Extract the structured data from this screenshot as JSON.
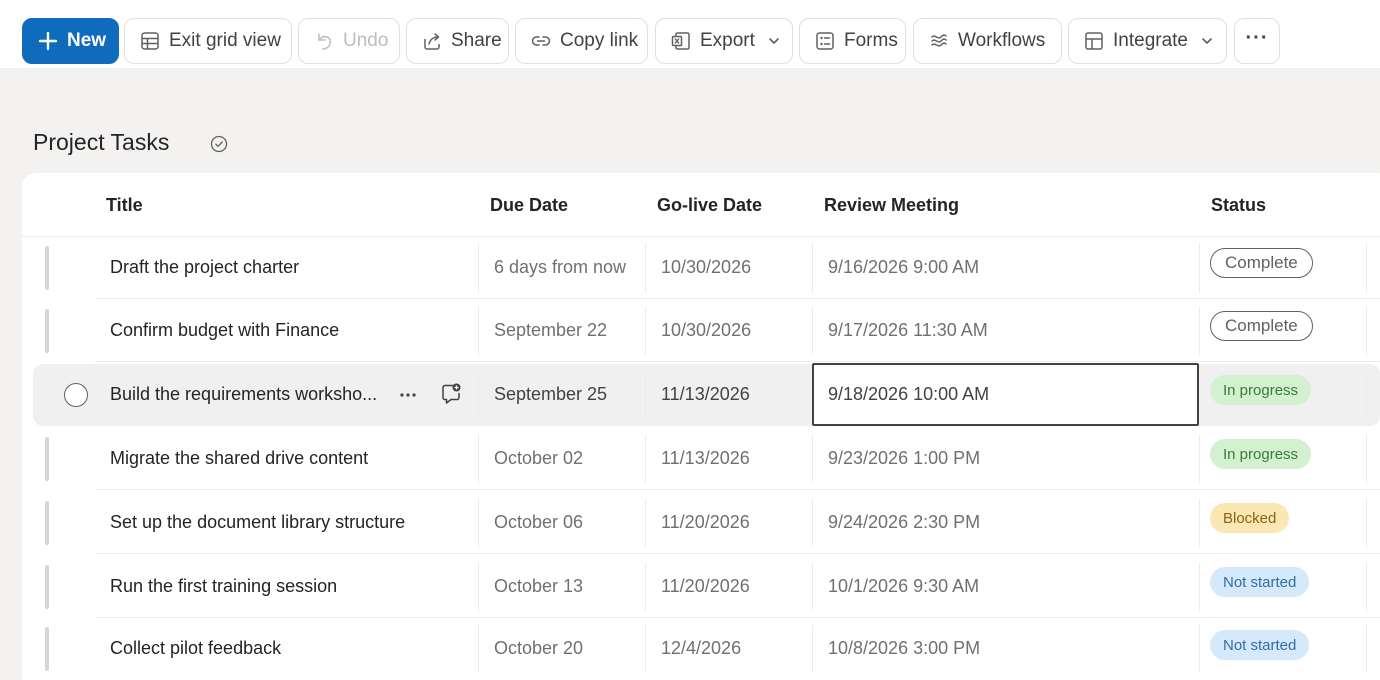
{
  "toolbar": {
    "new_label": "New",
    "exit_grid_label": "Exit grid view",
    "undo_label": "Undo",
    "share_label": "Share",
    "copy_link_label": "Copy link",
    "export_label": "Export",
    "forms_label": "Forms",
    "workflows_label": "Workflows",
    "integrate_label": "Integrate",
    "more_label": "···"
  },
  "list": {
    "title": "Project Tasks"
  },
  "columns": {
    "title": "Title",
    "due": "Due Date",
    "golive": "Go-live Date",
    "review": "Review Meeting",
    "status": "Status"
  },
  "rows": [
    {
      "title": "Draft the project charter",
      "due": "6 days from now",
      "golive": "10/30/2026",
      "review": "9/16/2026 9:00 AM",
      "status": "Complete",
      "status_kind": "complete"
    },
    {
      "title": "Confirm budget with Finance",
      "due": "September 22",
      "golive": "10/30/2026",
      "review": "9/17/2026 11:30 AM",
      "status": "Complete",
      "status_kind": "complete"
    },
    {
      "title": "Build the requirements worksho...",
      "due": "September 25",
      "golive": "11/13/2026",
      "review": "9/18/2026 10:00 AM",
      "status": "In progress",
      "status_kind": "inprogress"
    },
    {
      "title": "Migrate the shared drive content",
      "due": "October 02",
      "golive": "11/13/2026",
      "review": "9/23/2026 1:00 PM",
      "status": "In progress",
      "status_kind": "inprogress"
    },
    {
      "title": "Set up the document library structure",
      "due": "October 06",
      "golive": "11/20/2026",
      "review": "9/24/2026 2:30 PM",
      "status": "Blocked",
      "status_kind": "blocked"
    },
    {
      "title": "Run the first training session",
      "due": "October 13",
      "golive": "11/20/2026",
      "review": "10/1/2026 9:30 AM",
      "status": "Not started",
      "status_kind": "notstarted"
    },
    {
      "title": "Collect pilot feedback",
      "due": "October 20",
      "golive": "12/4/2026",
      "review": "10/8/2026 3:00 PM",
      "status": "Not started",
      "status_kind": "notstarted"
    }
  ],
  "colors": {
    "accent": "#0f6cbd",
    "complete": "#616161",
    "in_progress_bg": "#d3f0d0",
    "blocked_bg": "#fbe7b3",
    "not_started_bg": "#d6e9fb"
  }
}
